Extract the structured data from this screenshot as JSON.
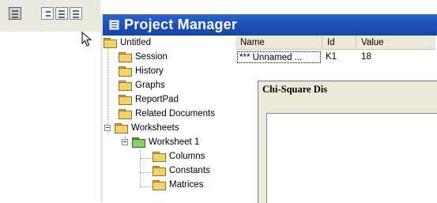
{
  "toolbar": {
    "buttons": [
      {
        "icon": "project-manager-icon"
      },
      {
        "icon": "session-icon"
      },
      {
        "icon": "worksheet-icon"
      },
      {
        "icon": "data-window-icon"
      }
    ]
  },
  "window": {
    "title": "Project Manager"
  },
  "tree": {
    "items": [
      {
        "label": "Untitled",
        "icon": "folder-icon"
      },
      {
        "label": "Session",
        "icon": "folder-icon"
      },
      {
        "label": "History",
        "icon": "folder-icon"
      },
      {
        "label": "Graphs",
        "icon": "folder-icon"
      },
      {
        "label": "ReportPad",
        "icon": "folder-icon"
      },
      {
        "label": "Related Documents",
        "icon": "folder-icon"
      },
      {
        "label": "Worksheets",
        "icon": "folder-icon"
      },
      {
        "label": "Worksheet 1",
        "icon": "folder-icon"
      },
      {
        "label": "Columns",
        "icon": "folder-icon"
      },
      {
        "label": "Constants",
        "icon": "folder-icon"
      },
      {
        "label": "Matrices",
        "icon": "folder-icon"
      }
    ]
  },
  "list": {
    "columns": [
      "Name",
      "Id",
      "Value"
    ],
    "rows": [
      {
        "name": "*** Unnamed ...",
        "id": "K1",
        "value": "18"
      }
    ]
  },
  "dialog": {
    "title": "Chi-Square Dis"
  },
  "colors": {
    "titlebar": "#1b4fb5",
    "folder": "#f2d36a",
    "worksheet_folder": "#8ccc6a"
  }
}
